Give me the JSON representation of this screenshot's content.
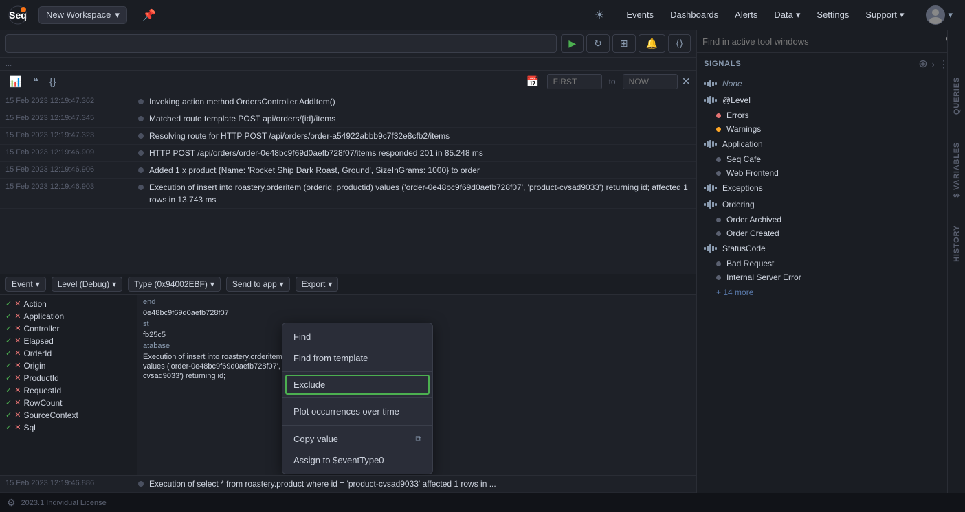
{
  "app": {
    "name": "Seq",
    "version": "2023.1",
    "license": "Individual License"
  },
  "topnav": {
    "workspace": "New Workspace",
    "links": [
      "Events",
      "Dashboards",
      "Alerts",
      "Data",
      "Settings",
      "Support"
    ]
  },
  "search": {
    "placeholder": "",
    "status": "...",
    "from_label": "FIRST",
    "to_label": "to",
    "to_value": "NOW"
  },
  "log_entries": [
    {
      "timestamp": "15 Feb 2023  12:19:47.362",
      "message": "Invoking action method OrdersController.AddItem()"
    },
    {
      "timestamp": "15 Feb 2023  12:19:47.345",
      "message": "Matched route template POST api/orders/{id}/items"
    },
    {
      "timestamp": "15 Feb 2023  12:19:47.323",
      "message": "Resolving route for HTTP POST /api/orders/order-a54922abbb9c7f32e8cfb2/items"
    },
    {
      "timestamp": "15 Feb 2023  12:19:46.909",
      "message": "HTTP POST /api/orders/order-0e48bc9f69d0aefb728f07/items responded 201 in 85.248 ms"
    },
    {
      "timestamp": "15 Feb 2023  12:19:46.906",
      "message": "Added 1 x product {Name: 'Rocket Ship Dark Roast, Ground', SizeInGrams: 1000} to order"
    },
    {
      "timestamp": "15 Feb 2023  12:19:46.903",
      "message": "Execution of insert into roastery.orderitem (orderid, productid) values ('order-0e48bc9f69d0aefb728f07', 'product-cvsad9033') returning id; affected 1 rows in 13.743 ms"
    }
  ],
  "filter_dropdowns": [
    {
      "label": "Event",
      "arrow": "▾"
    },
    {
      "label": "Level (Debug)",
      "arrow": "▾"
    },
    {
      "label": "Type (0x94002EBF)",
      "arrow": "▾"
    },
    {
      "label": "Send to app",
      "arrow": "▾"
    },
    {
      "label": "Export",
      "arrow": "▾"
    }
  ],
  "properties": [
    "Action",
    "Application",
    "Controller",
    "Elapsed",
    "OrderId",
    "Origin",
    "ProductId",
    "RequestId",
    "RowCount",
    "SourceContext",
    "Sql"
  ],
  "log_detail_lines": [
    "end",
    "0e48bc9f69d0aefb728f07",
    "st",
    "fb25c5",
    "atabase",
    "Execution of insert into roastery.orderitem (orderid, productid)",
    "values ('order-0e48bc9f69d0aefb728f07', 'product-",
    "cvsad9033') returning id;"
  ],
  "context_menu": {
    "items": [
      {
        "label": "Find",
        "highlighted": false
      },
      {
        "label": "Find from template",
        "highlighted": false
      },
      {
        "separator_after": true
      },
      {
        "label": "Exclude",
        "highlighted": true
      },
      {
        "separator_after": true
      },
      {
        "label": "Plot occurrences over time",
        "highlighted": false
      },
      {
        "separator_after": true
      },
      {
        "label": "Copy value",
        "has_icon": true,
        "highlighted": false
      },
      {
        "label": "Assign to $eventType0",
        "highlighted": false
      }
    ]
  },
  "right_panel": {
    "search_placeholder": "Find in active tool windows",
    "signals_label": "SIGNALS",
    "items": [
      {
        "type": "signal",
        "name": "None",
        "italic": true
      },
      {
        "type": "section",
        "name": "@Level",
        "expandable": true
      },
      {
        "type": "child",
        "name": "Errors",
        "color": "#e57373"
      },
      {
        "type": "child",
        "name": "Warnings",
        "color": "#ffa726"
      },
      {
        "type": "section",
        "name": "Application",
        "expandable": true
      },
      {
        "type": "child",
        "name": "Seq Cafe",
        "color": "#5a6070"
      },
      {
        "type": "child",
        "name": "Web Frontend",
        "color": "#5a6070"
      },
      {
        "type": "section",
        "name": "Exceptions",
        "expandable": false
      },
      {
        "type": "section",
        "name": "Ordering",
        "expandable": true
      },
      {
        "type": "child",
        "name": "Order Archived",
        "color": "#5a6070"
      },
      {
        "type": "child",
        "name": "Order Created",
        "color": "#5a6070"
      },
      {
        "type": "section",
        "name": "StatusCode",
        "expandable": true
      },
      {
        "type": "child",
        "name": "Bad Request",
        "color": "#5a6070"
      },
      {
        "type": "child",
        "name": "Internal Server Error",
        "color": "#5a6070"
      },
      {
        "type": "more",
        "label": "+ 14 more"
      }
    ],
    "tabs": [
      "QUERIES",
      "$ VARIABLES",
      "HISTORY"
    ]
  }
}
